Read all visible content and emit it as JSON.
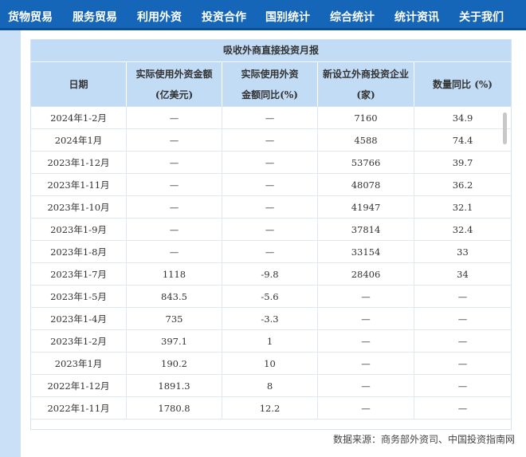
{
  "nav": {
    "items": [
      {
        "label": "货物贸易"
      },
      {
        "label": "服务贸易"
      },
      {
        "label": "利用外资"
      },
      {
        "label": "投资合作"
      },
      {
        "label": "国别统计"
      },
      {
        "label": "综合统计"
      },
      {
        "label": "统计资讯"
      },
      {
        "label": "关于我们"
      }
    ]
  },
  "table": {
    "title": "吸收外商直接投资月报",
    "headers": [
      {
        "line1": "日期",
        "line2": ""
      },
      {
        "line1": "实际使用外资金额",
        "line2": "(亿美元)"
      },
      {
        "line1": "实际使用外资",
        "line2": "金额同比(%)"
      },
      {
        "line1": "新设立外商投资企业",
        "line2": "(家)"
      },
      {
        "line1": "数量同比 (%)",
        "line2": ""
      }
    ],
    "rows": [
      [
        "2024年1-2月",
        "—",
        "—",
        "7160",
        "34.9"
      ],
      [
        "2024年1月",
        "—",
        "—",
        "4588",
        "74.4"
      ],
      [
        "2023年1-12月",
        "—",
        "—",
        "53766",
        "39.7"
      ],
      [
        "2023年1-11月",
        "—",
        "—",
        "48078",
        "36.2"
      ],
      [
        "2023年1-10月",
        "—",
        "—",
        "41947",
        "32.1"
      ],
      [
        "2023年1-9月",
        "—",
        "—",
        "37814",
        "32.4"
      ],
      [
        "2023年1-8月",
        "—",
        "—",
        "33154",
        "33"
      ],
      [
        "2023年1-7月",
        "1118",
        "-9.8",
        "28406",
        "34"
      ],
      [
        "2023年1-5月",
        "843.5",
        "-5.6",
        "—",
        "—"
      ],
      [
        "2023年1-4月",
        "735",
        "-3.3",
        "—",
        "—"
      ],
      [
        "2023年1-2月",
        "397.1",
        "1",
        "—",
        "—"
      ],
      [
        "2023年1月",
        "190.2",
        "10",
        "—",
        "—"
      ],
      [
        "2022年1-12月",
        "1891.3",
        "8",
        "—",
        "—"
      ],
      [
        "2022年1-11月",
        "1780.8",
        "12.2",
        "—",
        "—"
      ]
    ]
  },
  "source": "数据来源：商务部外资司、中国投资指南网",
  "colors": {
    "nav_bg": "#1566b9",
    "header_bg": "#c2dcf6",
    "side_strip": "#c9e0f7"
  }
}
